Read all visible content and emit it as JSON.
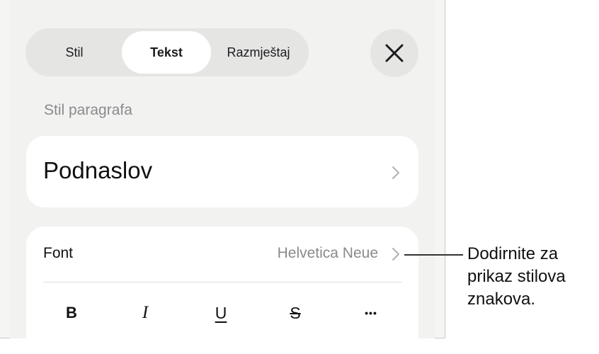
{
  "tabs": [
    {
      "label": "Stil",
      "active": false
    },
    {
      "label": "Tekst",
      "active": true
    },
    {
      "label": "Razmještaj",
      "active": false
    }
  ],
  "close_icon": "close-icon",
  "paragraph_style": {
    "section_label": "Stil paragrafa",
    "value": "Podnaslov"
  },
  "font": {
    "label": "Font",
    "value": "Helvetica Neue"
  },
  "format_buttons": [
    {
      "glyph": "B",
      "name": "bold"
    },
    {
      "glyph": "I",
      "name": "italic"
    },
    {
      "glyph": "U",
      "name": "underline"
    },
    {
      "glyph": "S",
      "name": "strikethrough"
    },
    {
      "glyph": "•••",
      "name": "more"
    }
  ],
  "callout": {
    "lines": [
      "Dodirnite za",
      "prikaz stilova",
      "znakova."
    ]
  },
  "colors": {
    "panel_bg": "#f2f2f1",
    "segment_bg": "#e5e5e4",
    "secondary_text": "#8a8a8e"
  }
}
